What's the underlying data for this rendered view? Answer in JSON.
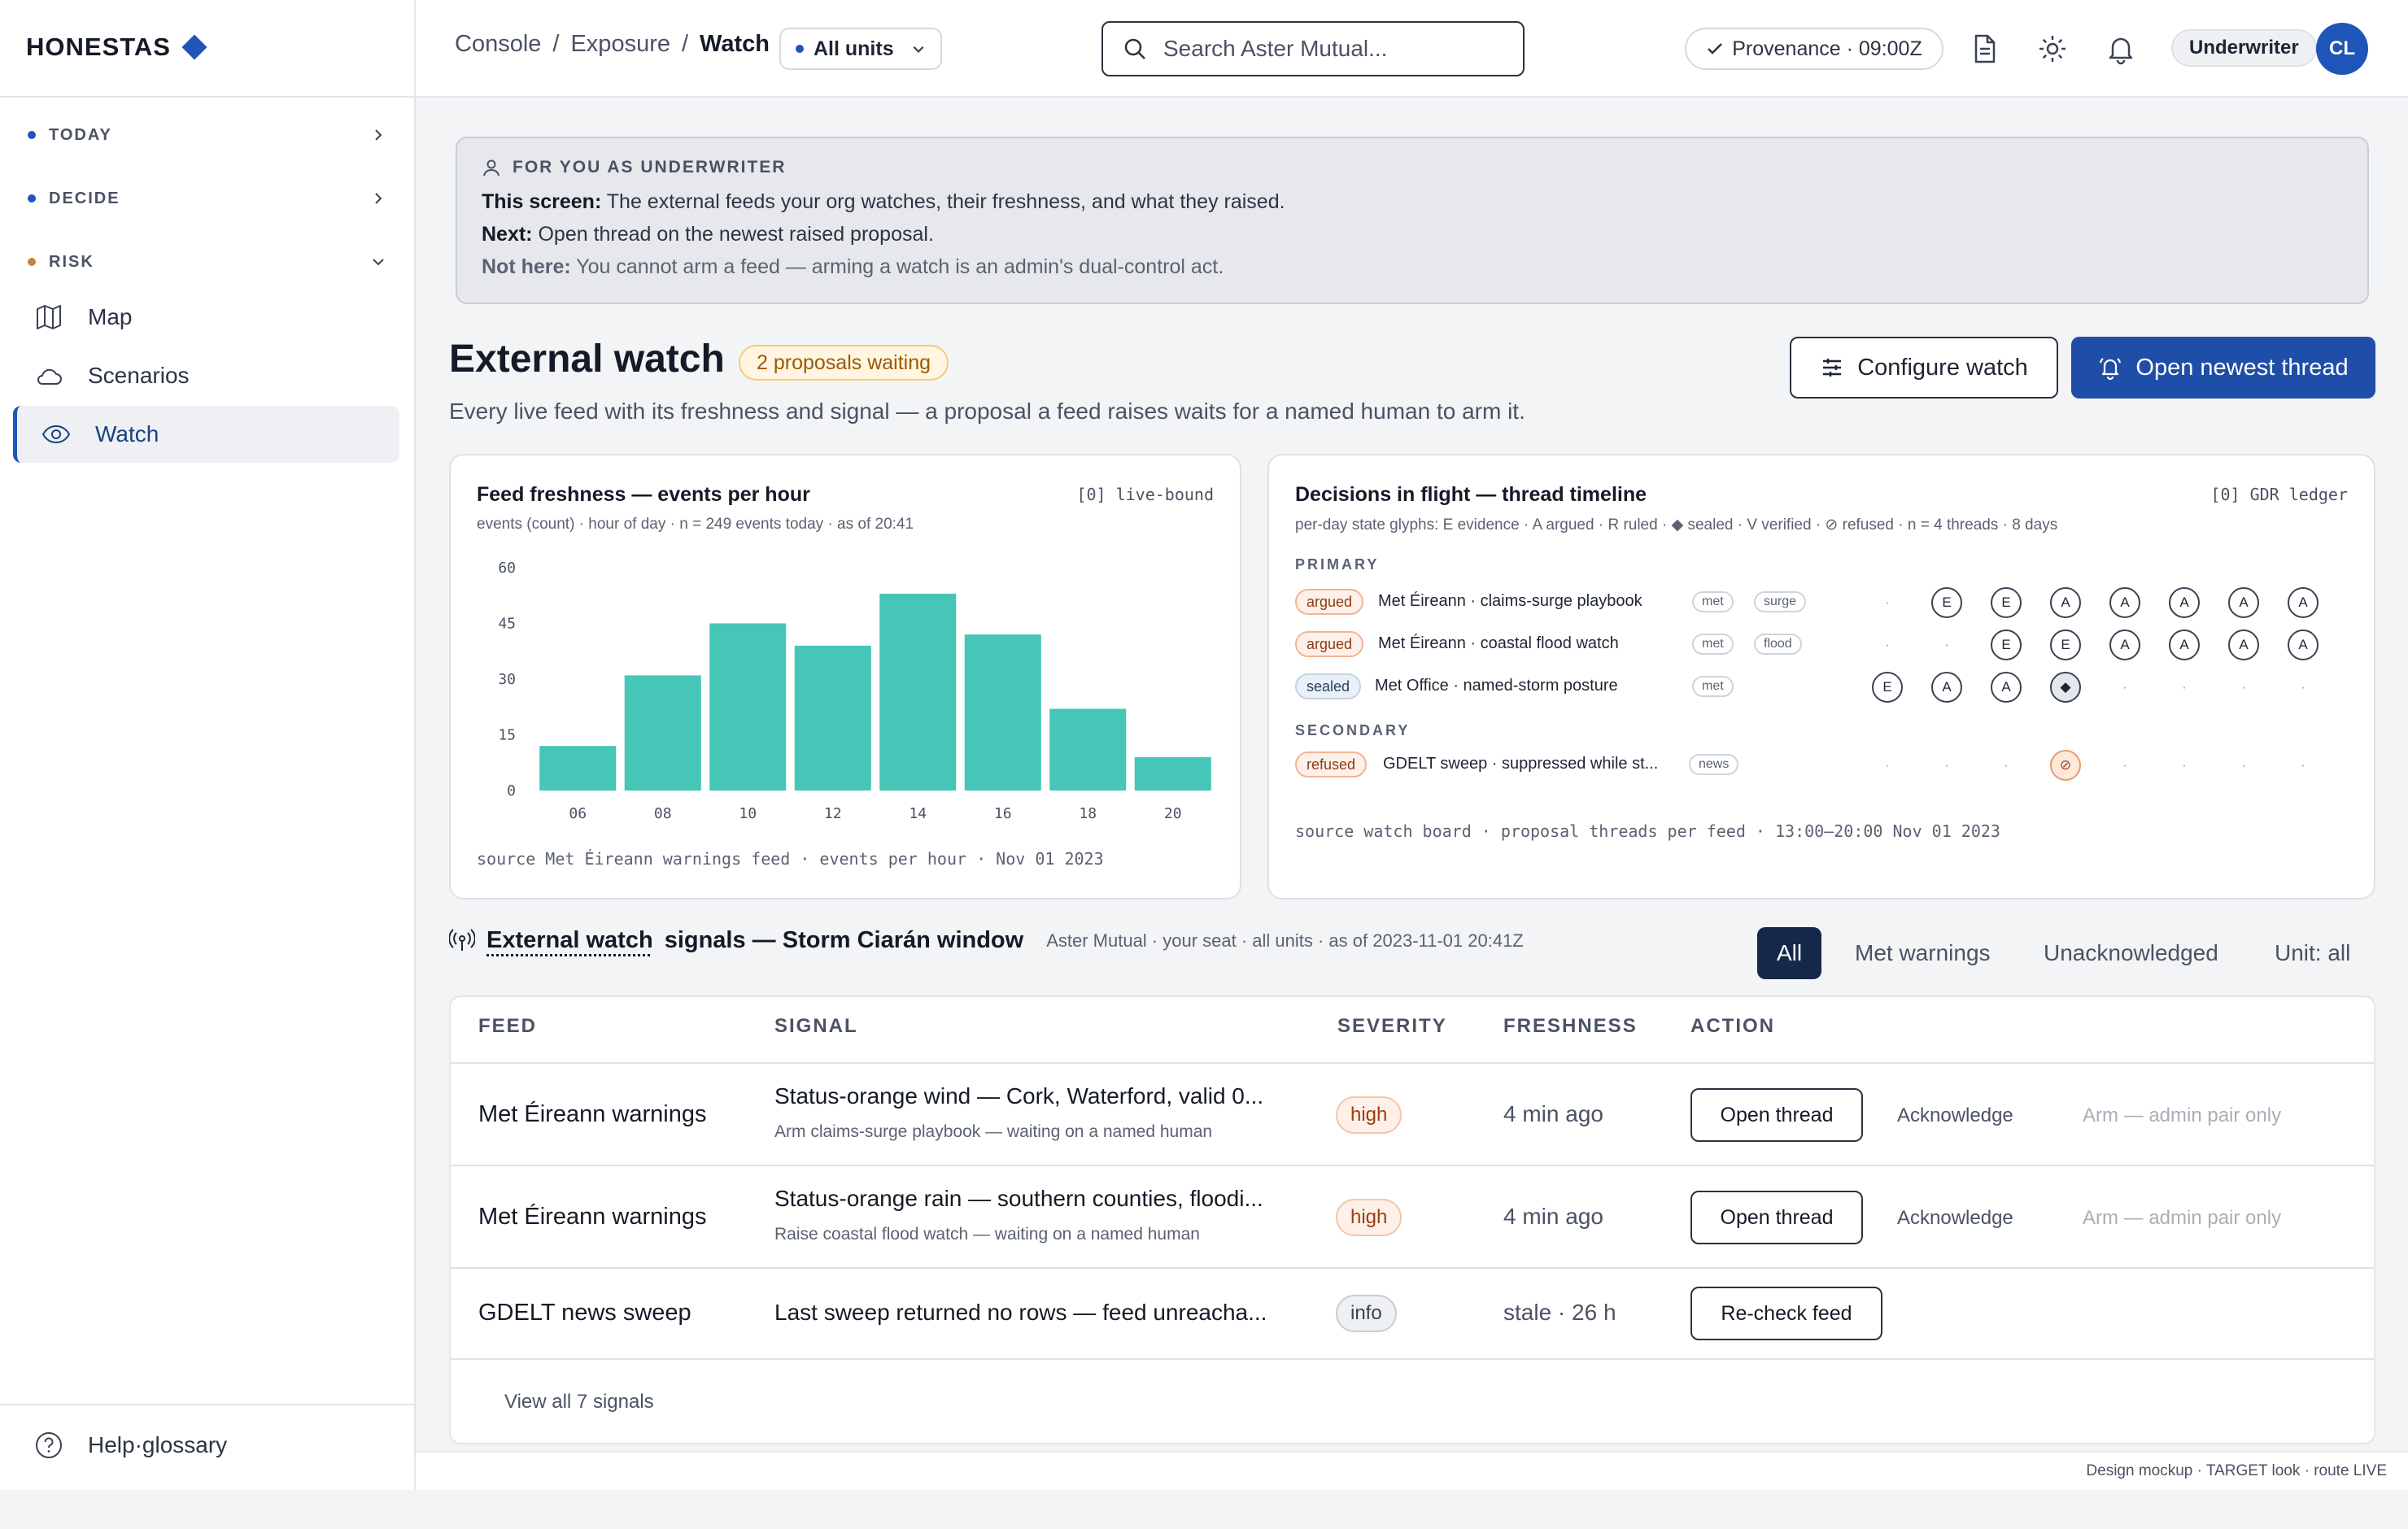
{
  "brand": {
    "name": "HONESTAS",
    "accent": "#1f55b8"
  },
  "sidebar": {
    "groups": [
      {
        "label": "TODAY",
        "dot": "#1f55b8"
      },
      {
        "label": "DECIDE",
        "dot": "#1f55b8"
      },
      {
        "label": "RISK",
        "dot": "#c6843a"
      }
    ],
    "items": [
      {
        "label": "Map",
        "icon": "map-icon"
      },
      {
        "label": "Scenarios",
        "icon": "cloud-icon"
      },
      {
        "label": "Watch",
        "icon": "eye-icon",
        "active": true
      }
    ],
    "help": "Help·glossary"
  },
  "header": {
    "breadcrumbs": [
      "Console",
      "Exposure",
      "Watch"
    ],
    "units": "All units",
    "search_placeholder": "Search Aster Mutual...",
    "provenance": "Provenance · 09:00Z",
    "role": "Underwriter",
    "avatar": "CL"
  },
  "banner": {
    "heading": "FOR YOU AS UNDERWRITER",
    "screen_label": "This screen:",
    "screen_text": "The external feeds your org watches, their freshness, and what they raised.",
    "next_label": "Next:",
    "next_text": "Open thread on the newest raised proposal.",
    "not_label": "Not here:",
    "not_text": "You cannot arm a feed — arming a watch is an admin's dual-control act."
  },
  "page": {
    "title": "External watch",
    "waiting": "2 proposals waiting",
    "subtitle": "Every live feed with its freshness and signal — a proposal a feed raises waits for a named human to arm it.",
    "configure": "Configure watch",
    "open_newest": "Open newest thread"
  },
  "freshness_card": {
    "title": "Feed freshness — events per hour",
    "tag": "[0] live-bound",
    "subtitle": "events (count) · hour of day · n = 249 events today · as of 20:41",
    "footer": "source Met Éireann warnings feed · events per hour · Nov 01 2023"
  },
  "chart_data": {
    "type": "bar",
    "categories": [
      "06",
      "08",
      "10",
      "12",
      "14",
      "16",
      "18",
      "20"
    ],
    "values": [
      12,
      31,
      45,
      39,
      53,
      42,
      22,
      9
    ],
    "title": "Feed freshness — events per hour",
    "xlabel": "",
    "ylabel": "",
    "ylim": [
      0,
      60
    ],
    "yticks": [
      0,
      15,
      30,
      45,
      60
    ],
    "color": "#45c6b6",
    "grid": false
  },
  "timeline_card": {
    "title": "Decisions in flight — thread timeline",
    "tag": "[0] GDR ledger",
    "subtitle": "per-day state glyphs: E evidence · A argued · R ruled · ◆ sealed · V verified · ⊘ refused · n = 4 threads · 8 days",
    "primary_label": "PRIMARY",
    "secondary_label": "SECONDARY",
    "footer": "source watch board · proposal threads per feed · 13:00–20:00 Nov 01 2023",
    "threads": [
      {
        "state": "argued",
        "name": "Met Éireann · claims-surge playbook",
        "tags": [
          "met",
          "surge"
        ],
        "glyphs": [
          "·",
          "E",
          "E",
          "A",
          "A",
          "A",
          "A",
          "A"
        ]
      },
      {
        "state": "argued",
        "name": "Met Éireann · coastal flood watch",
        "tags": [
          "met",
          "flood"
        ],
        "glyphs": [
          "·",
          "·",
          "E",
          "E",
          "A",
          "A",
          "A",
          "A"
        ]
      },
      {
        "state": "sealed",
        "name": "Met Office · named-storm posture",
        "tags": [
          "met"
        ],
        "glyphs": [
          "E",
          "A",
          "A",
          "◆",
          "·",
          "·",
          "·",
          "·"
        ]
      },
      {
        "state": "refused",
        "name": "GDELT sweep · suppressed while st...",
        "tags": [
          "news"
        ],
        "glyphs": [
          "·",
          "·",
          "·",
          "⊘",
          "·",
          "·",
          "·",
          "·"
        ]
      }
    ]
  },
  "signals": {
    "title_link": "External watch",
    "title_rest": "signals — Storm Ciarán window",
    "meta": "Aster Mutual · your seat · all units · as of 2023-11-01 20:41Z",
    "filters": [
      "All",
      "Met warnings",
      "Unacknowledged",
      "Unit: all"
    ],
    "columns": [
      "FEED",
      "SIGNAL",
      "SEVERITY",
      "FRESHNESS",
      "ACTION"
    ],
    "rows": [
      {
        "feed": "Met Éireann warnings",
        "signal": "Status-orange wind — Cork, Waterford, valid 0...",
        "sub": "Arm claims-surge playbook — waiting on a named human",
        "severity": "high",
        "freshness": "4 min ago",
        "action": "Open thread",
        "ack": "Acknowledge",
        "arm": "Arm — admin pair only"
      },
      {
        "feed": "Met Éireann warnings",
        "signal": "Status-orange rain — southern counties, floodi...",
        "sub": "Raise coastal flood watch — waiting on a named human",
        "severity": "high",
        "freshness": "4 min ago",
        "action": "Open thread",
        "ack": "Acknowledge",
        "arm": "Arm — admin pair only"
      },
      {
        "feed": "GDELT news sweep",
        "signal": "Last sweep returned no rows — feed unreacha...",
        "sub": "",
        "severity": "info",
        "freshness": "stale · 26 h",
        "action": "Re-check feed",
        "ack": "",
        "arm": ""
      }
    ],
    "view_all": "View all 7 signals"
  },
  "footer": "Design mockup · TARGET look · route LIVE"
}
